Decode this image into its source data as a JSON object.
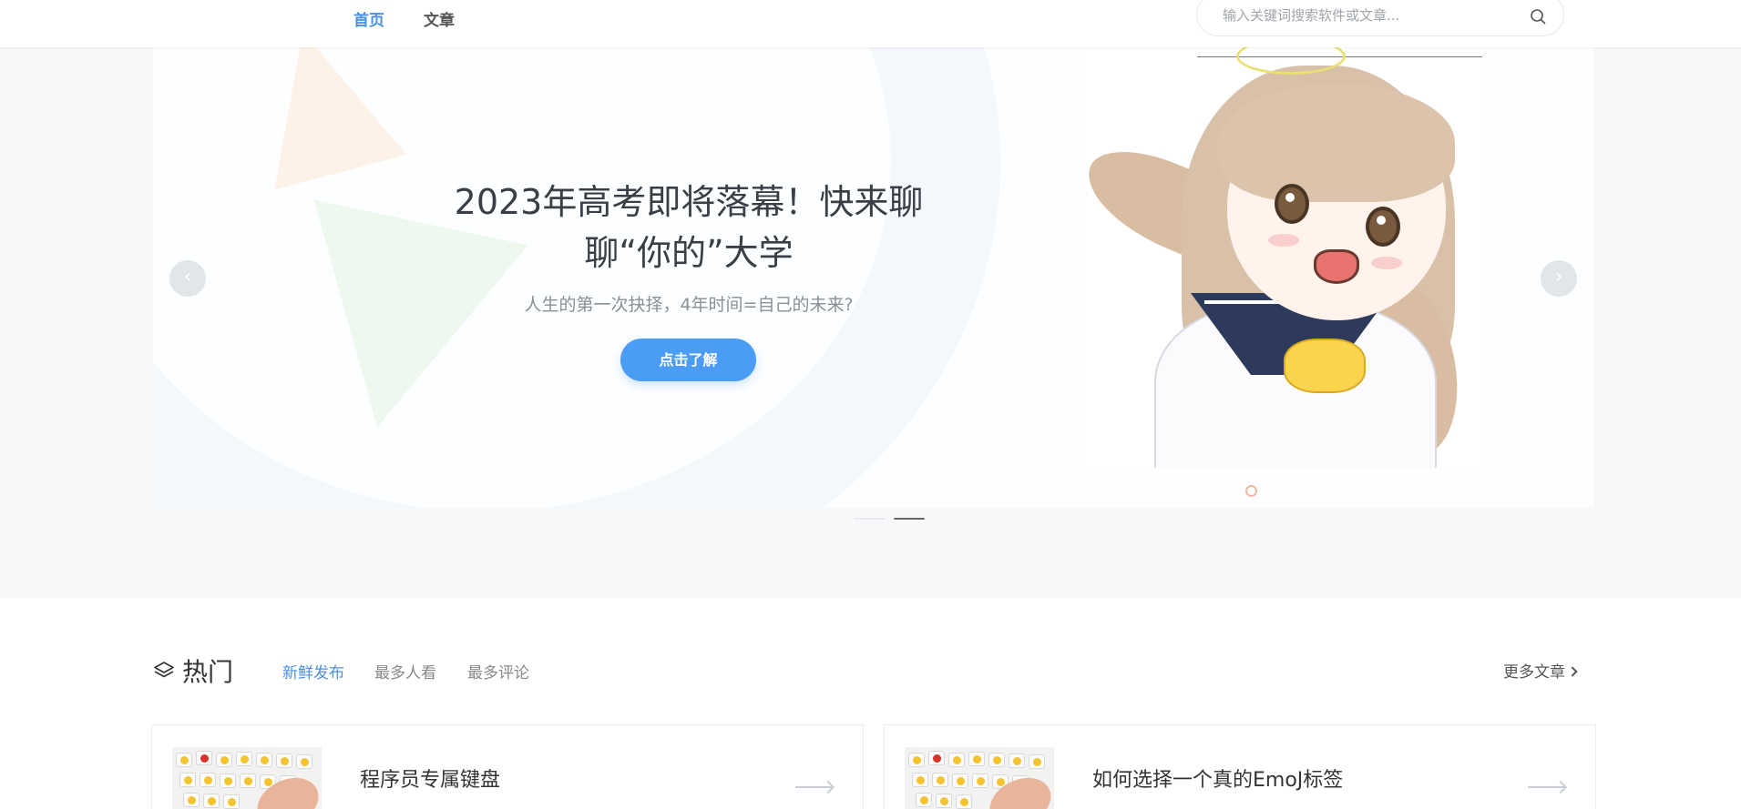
{
  "nav": {
    "home_label": "首页",
    "articles_label": "文章"
  },
  "search": {
    "placeholder": "输入关键词搜索软件或文章..."
  },
  "hero": {
    "title_line1": "2023年高考即将落幕！快来聊",
    "title_line2": "聊“你的”大学",
    "subtitle": "人生的第一次抉择，4年时间=自己的未来?",
    "cta_label": "点击了解",
    "prev_label": "‹",
    "next_label": "›",
    "active_slide": 2,
    "slide_count": 2
  },
  "hot": {
    "title": "热门",
    "tabs": [
      "新鲜发布",
      "最多人看",
      "最多评论"
    ],
    "active_tab": "新鲜发布",
    "more_label": "更多文章"
  },
  "cards": [
    {
      "title": "程序员专属键盘"
    },
    {
      "title": "如何选择一个真的EmoJ标签"
    }
  ],
  "colors": {
    "accent": "#4a90e2",
    "cta": "#4a9cf5",
    "hero_bg": "#f7f8fa"
  }
}
